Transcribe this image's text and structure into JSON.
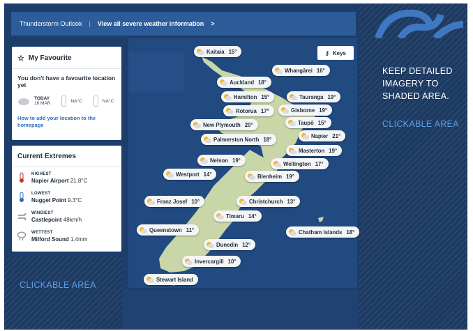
{
  "topbar": {
    "title": "Thunderstorm Outlook",
    "link": "View all severe weather information",
    "link_arrow": ">"
  },
  "favourite": {
    "title": "My Favourite",
    "message": "You don't have a favourite location yet",
    "today_label": "TODAY",
    "date": "16 MAR",
    "temp_high": "NA°C",
    "temp_low": "NA°C",
    "help_link": "How to add your location to the homepage"
  },
  "extremes": {
    "title": "Current Extremes",
    "items": [
      {
        "label": "HIGHEST",
        "location": "Napier Airport",
        "value": "21.8°C"
      },
      {
        "label": "LOWEST",
        "location": "Nugget Point",
        "value": "9.3°C"
      },
      {
        "label": "WINDIEST",
        "location": "Castlepoint",
        "value": "48km/h"
      },
      {
        "label": "WETTEST",
        "location": "Milford Sound",
        "value": "1.4mm"
      }
    ]
  },
  "keys_label": "Keys",
  "locations": [
    {
      "name": "Kaitaia",
      "temp": "15°"
    },
    {
      "name": "Whangārei",
      "temp": "16°"
    },
    {
      "name": "Auckland",
      "temp": "18°"
    },
    {
      "name": "Hamilton",
      "temp": "15°"
    },
    {
      "name": "Tauranga",
      "temp": "19°"
    },
    {
      "name": "Rotorua",
      "temp": "17°"
    },
    {
      "name": "Gisborne",
      "temp": "19°"
    },
    {
      "name": "Taupō",
      "temp": "15°"
    },
    {
      "name": "New Plymouth",
      "temp": "20°"
    },
    {
      "name": "Napier",
      "temp": "21°"
    },
    {
      "name": "Palmerston North",
      "temp": "18°"
    },
    {
      "name": "Masterton",
      "temp": "19°"
    },
    {
      "name": "Nelson",
      "temp": "19°"
    },
    {
      "name": "Wellington",
      "temp": "17°"
    },
    {
      "name": "Westport",
      "temp": "14°"
    },
    {
      "name": "Blenheim",
      "temp": "19°"
    },
    {
      "name": "Franz Josef",
      "temp": "10°"
    },
    {
      "name": "Christchurch",
      "temp": "13°"
    },
    {
      "name": "Timaru",
      "temp": "14°"
    },
    {
      "name": "Chatham Islands",
      "temp": "18°"
    },
    {
      "name": "Queenstown",
      "temp": "11°"
    },
    {
      "name": "Dunedin",
      "temp": "12°"
    },
    {
      "name": "Invercargill",
      "temp": "10°"
    },
    {
      "name": "Stewart Island",
      "temp": ""
    }
  ],
  "annotations": {
    "right_note": "KEEP DETAILED IMAGERY TO SHADED AREA.",
    "right_clickable": "CLICKABLE AREA",
    "bottom_clickable": "CLICKABLE AREA"
  },
  "colors": {
    "sea": "#214a80",
    "topbar": "#2c5c99",
    "land": "#c9d7a8",
    "annotation_blue": "#5d9cdf"
  }
}
